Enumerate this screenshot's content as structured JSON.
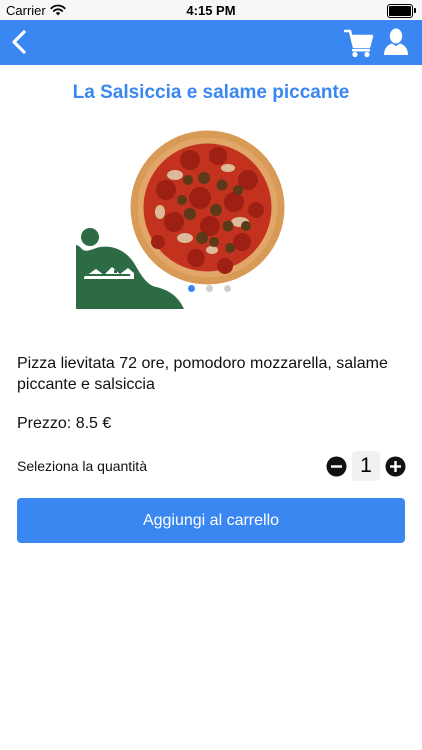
{
  "status_bar": {
    "carrier": "Carrier",
    "time": "4:15 PM",
    "icons": [
      "wifi-icon",
      "battery-icon"
    ]
  },
  "nav_bar": {
    "background_color": "#3a87f2",
    "icons": [
      "chevron-left-icon",
      "cart-icon",
      "user-icon"
    ]
  },
  "product": {
    "title": "La Salsiccia e salame piccante",
    "description": "Pizza lievitata 72 ore, pomodoro mozzarella, salame piccante e salsiccia",
    "price_label": "Prezzo:",
    "price_value": "8.5 €",
    "image_carousel": {
      "page_count": 3,
      "current_page": 1
    }
  },
  "quantity": {
    "label": "Seleziona la quantità",
    "value": "1"
  },
  "actions": {
    "add_to_cart_label": "Aggiungi al carrello"
  },
  "colors": {
    "accent": "#3a87f2",
    "logo_green": "#2d6b45"
  }
}
